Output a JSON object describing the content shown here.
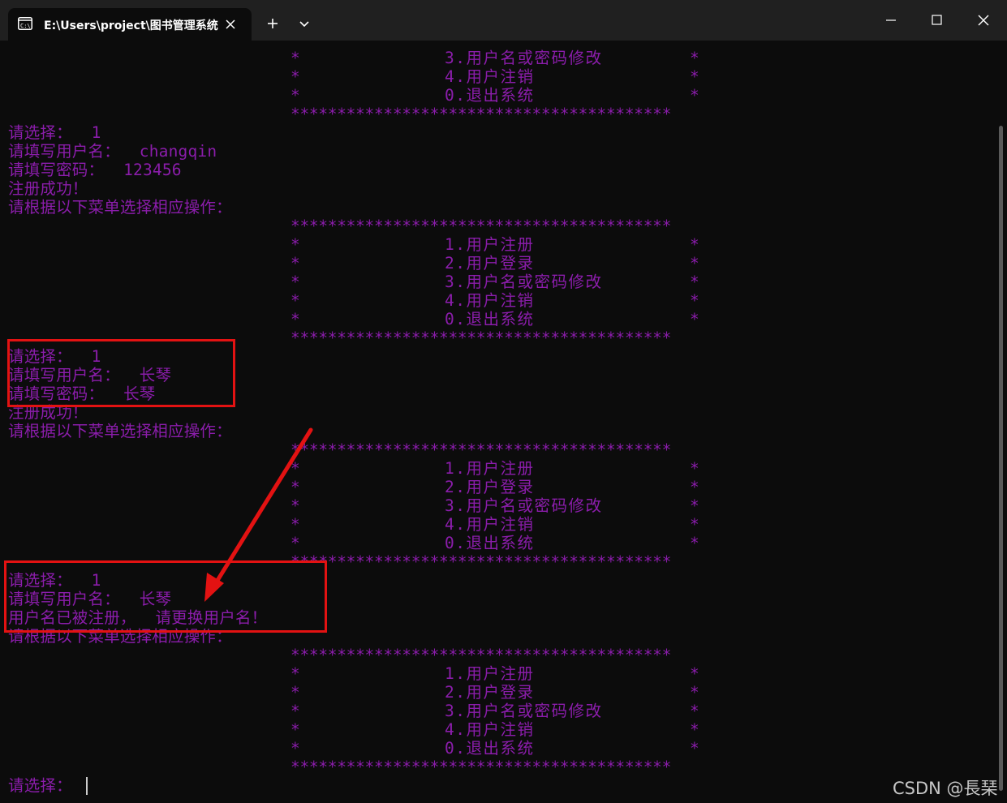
{
  "window": {
    "tab_title": "E:\\Users\\project\\图书管理系统",
    "icons": [
      "terminal-icon",
      "close-icon",
      "plus-icon",
      "chevron-down-icon",
      "minimize-icon",
      "maximize-icon",
      "window-close-icon"
    ]
  },
  "menu": {
    "border": "*****************************************",
    "star": "*",
    "items": [
      "1.用户注册",
      "2.用户登录",
      "3.用户名或密码修改",
      "4.用户注销",
      "0.退出系统"
    ]
  },
  "output": {
    "top_items": [
      "3.用户名或密码修改",
      "4.用户注销",
      "0.退出系统"
    ],
    "choose_1": "请选择：  1",
    "username_1": "请填写用户名：  changqin",
    "password_1": "请填写密码：  123456",
    "success": "注册成功！",
    "prompt": "请根据以下菜单选择相应操作：",
    "choose_2": "请选择：  1",
    "username_2": "请填写用户名：  长琴",
    "password_2": "请填写密码：  长琴",
    "success_2": "注册成功！",
    "prompt_2": "请根据以下菜单选择相应操作：",
    "choose_3": "请选择：  1",
    "username_3": "请填写用户名：  长琴",
    "error_3": "用户名已被注册，  请更换用户名！",
    "prompt_3": "请根据以下菜单选择相应操作：",
    "final_prompt": "请选择："
  },
  "watermark": "CSDN @長琹",
  "colors": {
    "text": "#8b1dab",
    "background": "#0c0c0c",
    "annotation": "#e31212"
  }
}
